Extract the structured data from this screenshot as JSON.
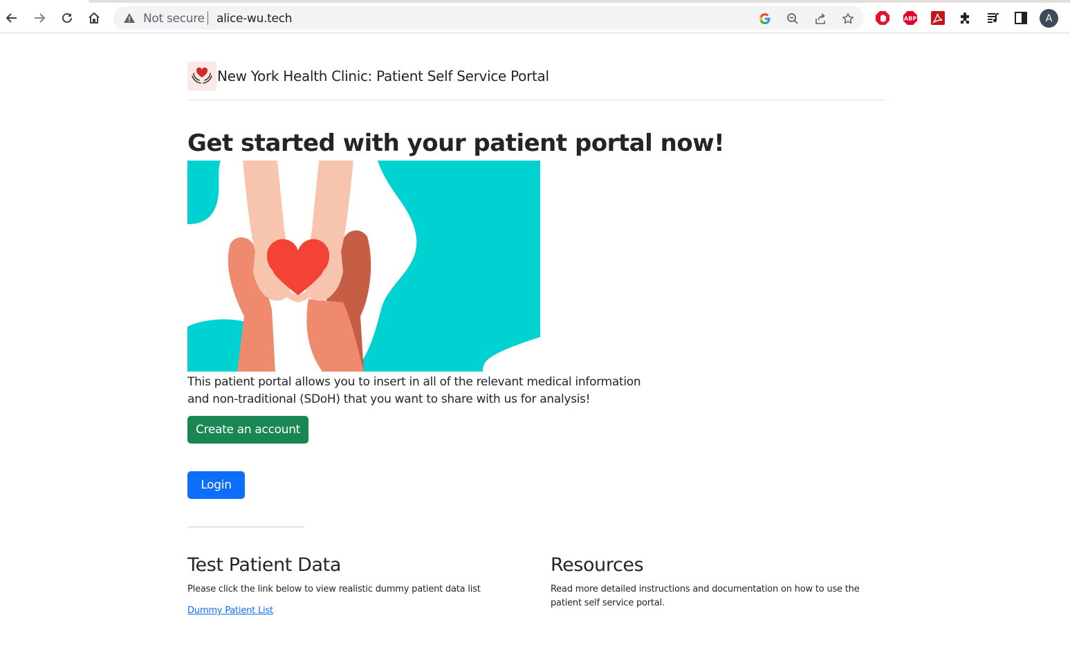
{
  "browser": {
    "omnibox": {
      "security_label": "Not secure",
      "url": "alice-wu.tech"
    },
    "profile_initial": "A",
    "extensions": [
      "adblock-icon",
      "abp-icon",
      "pdf-icon",
      "extensions-puzzle-icon",
      "media-control-icon",
      "side-panel-icon"
    ]
  },
  "header": {
    "brand_text": "New York Health Clinic: Patient Self Service Portal"
  },
  "hero": {
    "title": "Get started with your patient portal now!",
    "description": "This patient portal allows you to insert in all of the relevant medical information and non-traditional (SDoH) that you want to share with us for analysis!",
    "create_account_label": "Create an account",
    "login_label": "Login"
  },
  "sections": {
    "test_data": {
      "title": "Test Patient Data",
      "text": "Please click the link below to view realistic dummy patient data list",
      "link": "Dummy Patient List"
    },
    "resources": {
      "title": "Resources",
      "text": "Read more detailed instructions and documentation on how to use the patient self service portal."
    }
  },
  "colors": {
    "success_button": "#198754",
    "primary_button": "#0d6efd",
    "hero_teal": "#00d1d1",
    "heart_red": "#f44336"
  }
}
